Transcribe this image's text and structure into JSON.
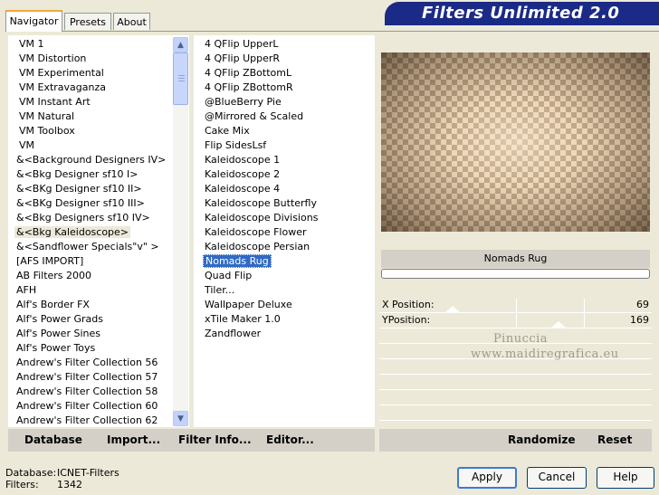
{
  "tabs": [
    {
      "label": "Navigator",
      "active": true
    },
    {
      "label": "Presets",
      "active": false
    },
    {
      "label": "About",
      "active": false
    }
  ],
  "banner": {
    "title": "Filters Unlimited 2.0"
  },
  "categories": [
    "VM 1",
    "VM Distortion",
    "VM Experimental",
    "VM Extravaganza",
    "VM Instant Art",
    "VM Natural",
    "VM Toolbox",
    "VM",
    "&<Background Designers IV>",
    "&<Bkg Designer sf10 I>",
    "&<BKg Designer sf10 II>",
    "&<BKg Designer sf10 III>",
    "&<Bkg Designers sf10 IV>",
    "&<Bkg Kaleidoscope>",
    "&<Sandflower Specials\"v\" >",
    "[AFS IMPORT]",
    "AB Filters 2000",
    "AFH",
    "Alf's Border FX",
    "Alf's Power Grads",
    "Alf's Power Sines",
    "Alf's Power Toys",
    "Andrew's Filter Collection 56",
    "Andrew's Filter Collection 57",
    "Andrew's Filter Collection 58",
    "Andrew's Filter Collection 60",
    "Andrew's Filter Collection 62"
  ],
  "filters": [
    "4 QFlip UpperL",
    "4 QFlip UpperR",
    "4 QFlip ZBottomL",
    "4 QFlip ZBottomR",
    "@BlueBerry Pie",
    "@Mirrored & Scaled",
    "Cake Mix",
    "Flip SidesLsf",
    "Kaleidoscope 1",
    "Kaleidoscope 2",
    "Kaleidoscope 4",
    "Kaleidoscope Butterfly",
    "Kaleidoscope Divisions",
    "Kaleidoscope Flower",
    "Kaleidoscope Persian",
    "Nomads Rug",
    "Quad Flip",
    "Tiler...",
    "Wallpaper Deluxe",
    "xTile Maker 1.0",
    "Zandflower"
  ],
  "left_buttons": {
    "database": "Database",
    "import": "Import...",
    "filter_info": "Filter Info...",
    "editor": "Editor..."
  },
  "right_buttons": {
    "randomize": "Randomize",
    "reset": "Reset"
  },
  "selected_filter_name": "Nomads Rug",
  "controls": [
    {
      "label": "X Position:",
      "value": "69"
    },
    {
      "label": "YPosition:",
      "value": "169"
    }
  ],
  "watermark": {
    "line1": "Pinuccia",
    "line2": "www.maidiregrafica.eu"
  },
  "footer": {
    "database_label": "Database:",
    "database_value": "ICNET-Filters",
    "filters_label": "Filters:",
    "filters_value": "1342"
  },
  "dialog_buttons": {
    "apply": "Apply",
    "cancel": "Cancel",
    "help": "Help"
  }
}
